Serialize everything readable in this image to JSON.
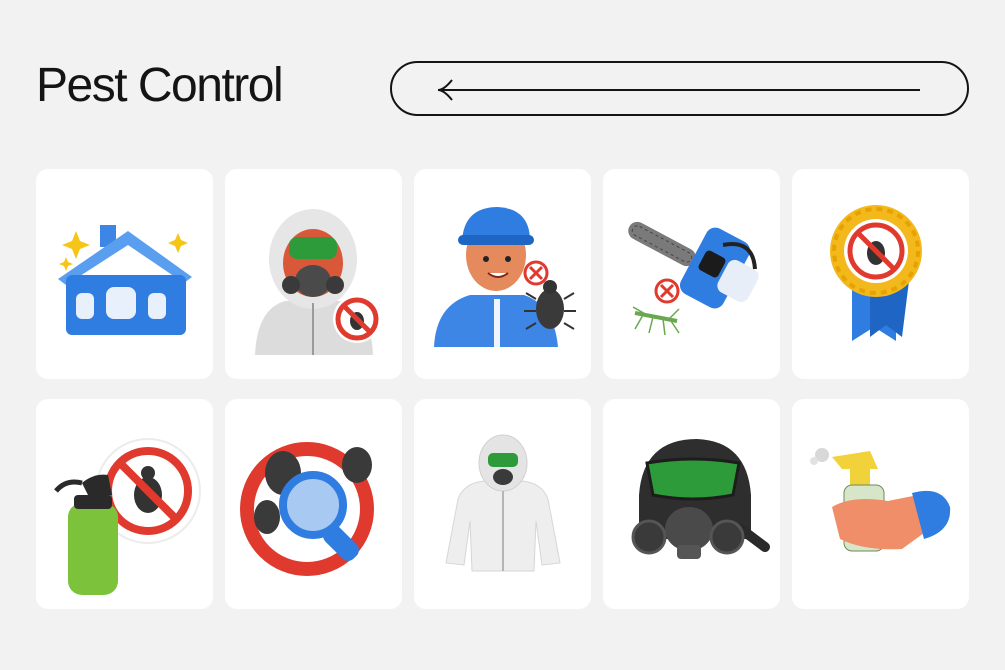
{
  "header": {
    "title": "Pest Control",
    "back_control_icon": "arrow-left-icon"
  },
  "icons": [
    {
      "name": "house-icon"
    },
    {
      "name": "hazmat-worker-icon"
    },
    {
      "name": "exterminator-icon"
    },
    {
      "name": "fogger-machine-icon"
    },
    {
      "name": "pest-free-badge-icon"
    },
    {
      "name": "spray-bottle-icon"
    },
    {
      "name": "bug-inspection-icon"
    },
    {
      "name": "protective-suit-icon"
    },
    {
      "name": "gas-mask-icon"
    },
    {
      "name": "hand-spray-icon"
    }
  ],
  "colors": {
    "background": "#f2f2f2",
    "card": "#ffffff",
    "text": "#141414",
    "blue": "#2f7de1",
    "red": "#e03a2e",
    "green": "#2e9b3a"
  }
}
